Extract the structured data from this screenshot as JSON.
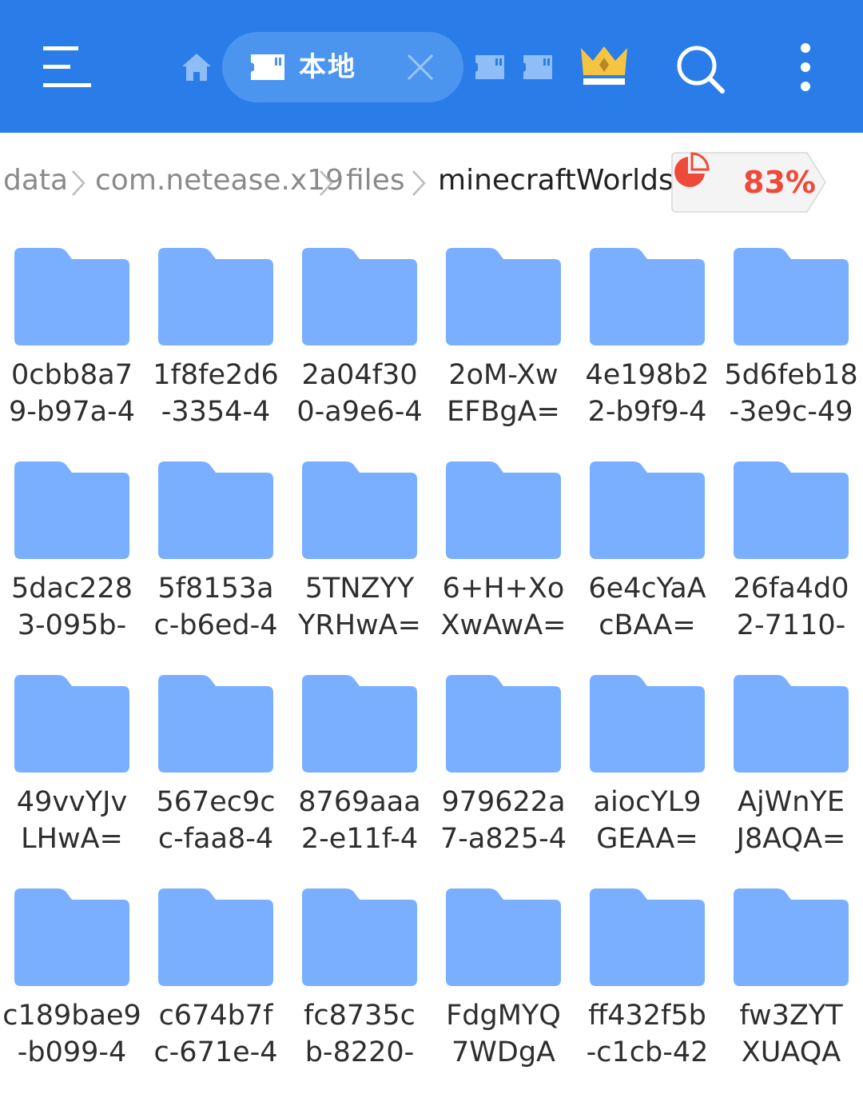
{
  "header": {
    "tab_label": "本地",
    "colors": {
      "bar": "#2a7de8",
      "pill": "#4c95ef",
      "crown": "#f5c542"
    },
    "icons": [
      "menu-icon",
      "home-icon",
      "sd-card-icon",
      "close-icon",
      "sd-card-icon",
      "sd-card-icon",
      "crown-icon",
      "search-icon",
      "more-vertical-icon"
    ]
  },
  "breadcrumb": {
    "items": [
      "data",
      "com.netease.x19",
      "files",
      "minecraftWorlds"
    ],
    "storage_percent": "83%",
    "storage_color": "#ee4a3a"
  },
  "folders": [
    {
      "line1": "0cbb8a7",
      "line2": "9-b97a-4"
    },
    {
      "line1": "1f8fe2d6",
      "line2": "-3354-4"
    },
    {
      "line1": "2a04f30",
      "line2": "0-a9e6-4"
    },
    {
      "line1": "2oM-Xw",
      "line2": "EFBgA="
    },
    {
      "line1": "4e198b2",
      "line2": "2-b9f9-4"
    },
    {
      "line1": "5d6feb18",
      "line2": "-3e9c-49"
    },
    {
      "line1": "5dac228",
      "line2": "3-095b-"
    },
    {
      "line1": "5f8153a",
      "line2": "c-b6ed-4"
    },
    {
      "line1": "5TNZYY",
      "line2": "YRHwA="
    },
    {
      "line1": "6+H+Xo",
      "line2": "XwAwA="
    },
    {
      "line1": "6e4cYaA",
      "line2": "cBAA="
    },
    {
      "line1": "26fa4d0",
      "line2": "2-7110-"
    },
    {
      "line1": "49vvYJv",
      "line2": "LHwA="
    },
    {
      "line1": "567ec9c",
      "line2": "c-faa8-4"
    },
    {
      "line1": "8769aaa",
      "line2": "2-e11f-4"
    },
    {
      "line1": "979622a",
      "line2": "7-a825-4"
    },
    {
      "line1": "aiocYL9",
      "line2": "GEAA="
    },
    {
      "line1": "AjWnYE",
      "line2": "J8AQA="
    },
    {
      "line1": "c189bae9",
      "line2": "-b099-4"
    },
    {
      "line1": "c674b7f",
      "line2": "c-671e-4"
    },
    {
      "line1": "fc8735c",
      "line2": "b-8220-"
    },
    {
      "line1": "FdgMYQ",
      "line2": "7WDgA"
    },
    {
      "line1": "ff432f5b",
      "line2": "-c1cb-42"
    },
    {
      "line1": "fw3ZYT",
      "line2": "XUAQA"
    }
  ],
  "folder_color": "#7aafff"
}
